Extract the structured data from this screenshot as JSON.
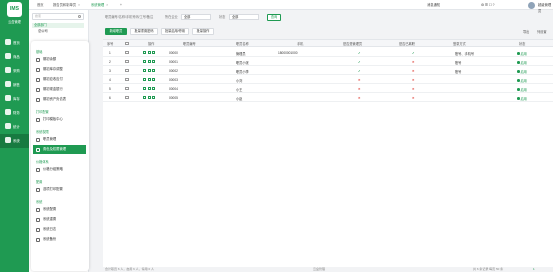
{
  "app": {
    "logo_mark": "IMS",
    "logo_name": "云盒管理"
  },
  "leftnav": [
    {
      "label": "首页",
      "active": false
    },
    {
      "label": "商品",
      "active": false
    },
    {
      "label": "采购",
      "active": false
    },
    {
      "label": "销售",
      "active": false
    },
    {
      "label": "库存",
      "active": false
    },
    {
      "label": "财务",
      "active": false
    },
    {
      "label": "统计",
      "active": false
    },
    {
      "label": "系统",
      "active": true
    }
  ],
  "topbar": {
    "tabs": [
      {
        "label": "首页",
        "active": false
      },
      {
        "label": "报告员和制单员",
        "active": false,
        "close": "×"
      },
      {
        "label": "系统管理",
        "active": true,
        "close": "×"
      }
    ],
    "add_tab": "+",
    "right": {
      "notice": "消息通知",
      "user": "超级管理员"
    }
  },
  "tree": {
    "search_placeholder": "搜索",
    "nodes": [
      {
        "label": "全部部门"
      },
      {
        "label": "总公司"
      }
    ]
  },
  "menu": {
    "groups": [
      {
        "title": "基础",
        "items": [
          "期初余额",
          "期初库存调整",
          "期初应收应付",
          "期初现金银行",
          "期初资产负债表"
        ]
      },
      {
        "title": "打印配置",
        "items": [
          "打印模板中心"
        ]
      },
      {
        "title": "系统权限",
        "items": [
          "职员管理",
          "角色及权限管理"
        ]
      },
      {
        "title": "价格体系",
        "items": [
          "价格分组策略"
        ]
      },
      {
        "title": "配置",
        "items": [
          "选项打印配置"
        ]
      },
      {
        "title": "系统",
        "items": [
          "系统配置",
          "系统重置",
          "系统日志",
          "系统备份"
        ]
      }
    ],
    "active_item": "角色及权限管理"
  },
  "filters": {
    "f1_label": "职员编号/名称/手机号码/工号/备注",
    "f2_label": "所在企业",
    "f2_value": "全部",
    "f3_label": "状态",
    "f3_value": "全部",
    "query": "查询"
  },
  "toolbar": {
    "new": "新增职员",
    "b2": "批量重置密码",
    "b3": "批量启用/停用",
    "b4": "批量操作",
    "right1": "导出",
    "right2": "列设置"
  },
  "table": {
    "columns": [
      "序号",
      "操作",
      "职员编号",
      "职员名称",
      "手机",
      "是否是管理员",
      "是否已离职",
      "登录方式",
      "状态"
    ],
    "rows": [
      {
        "idx": "1",
        "code": "00000",
        "name": "管理员",
        "phone": "18000001000",
        "admin": "yes",
        "left": "yes",
        "login": "账号、手机号",
        "status": "启用"
      },
      {
        "idx": "2",
        "code": "00001",
        "name": "职员小张",
        "phone": "",
        "admin": "yes",
        "left": "no",
        "login": "账号",
        "status": "启用"
      },
      {
        "idx": "3",
        "code": "00002",
        "name": "职员小李",
        "phone": "",
        "admin": "yes",
        "left": "no",
        "login": "账号",
        "status": "启用"
      },
      {
        "idx": "4",
        "code": "00003",
        "name": "小刘",
        "phone": "",
        "admin": "no",
        "left": "no",
        "login": "",
        "status": "启用"
      },
      {
        "idx": "5",
        "code": "00004",
        "name": "小王",
        "phone": "",
        "admin": "no",
        "left": "no",
        "login": "",
        "status": "启用"
      },
      {
        "idx": "6",
        "code": "00005",
        "name": "小赵",
        "phone": "",
        "admin": "no",
        "left": "no",
        "login": "",
        "status": "启用"
      }
    ]
  },
  "footer": {
    "left": "合计职员 6 人，启用 6 人，停用 0 人",
    "right": "共 6 条记录  每页 50 条",
    "pager": "1",
    "center": "云盒管理"
  },
  "colors": {
    "accent": "#1f9a52",
    "danger": "#e0453d"
  }
}
